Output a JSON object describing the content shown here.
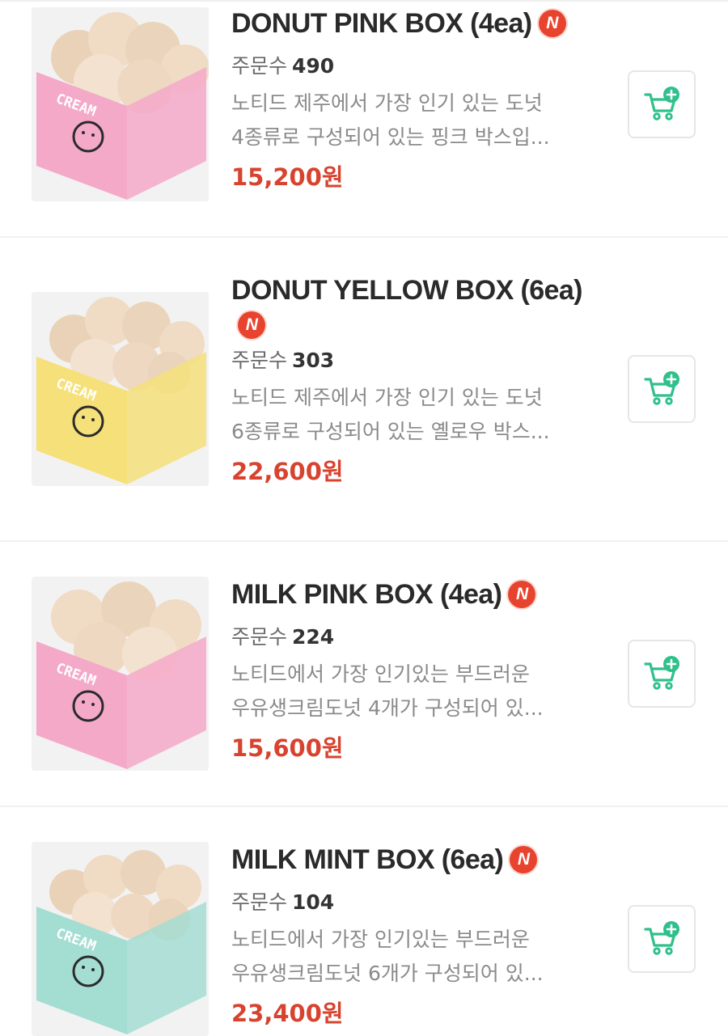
{
  "labels": {
    "orders_prefix": "주문수"
  },
  "badge_text": "N",
  "icons": {
    "badge": "new-badge-icon",
    "cart": "cart-add-icon"
  },
  "colors": {
    "price": "#d8432f",
    "badge": "#e8432e",
    "cart": "#2fc08b"
  },
  "products": [
    {
      "title": "DONUT PINK BOX (4ea)",
      "orders": "490",
      "desc_line1": "노티드 제주에서 가장 인기 있는 도넛",
      "desc_line2": "4종류로 구성되어 있는 핑크 박스입...",
      "price": "15,200원",
      "box_color": "#f4a9c9",
      "box_text": "CREAM"
    },
    {
      "title": "DONUT YELLOW BOX (6ea)",
      "orders": "303",
      "desc_line1": "노티드 제주에서 가장 인기 있는 도넛",
      "desc_line2": "6종류로 구성되어 있는 옐로우 박스...",
      "price": "22,600원",
      "box_color": "#f5e07a",
      "box_text": "CREAM"
    },
    {
      "title": "MILK PINK BOX (4ea)",
      "orders": "224",
      "desc_line1": "노티드에서 가장 인기있는 부드러운",
      "desc_line2": "우유생크림도넛 4개가 구성되어 있...",
      "price": "15,600원",
      "box_color": "#f4a9c9",
      "box_text": "CREAM"
    },
    {
      "title": "MILK MINT BOX (6ea)",
      "orders": "104",
      "desc_line1": "노티드에서 가장 인기있는 부드러운",
      "desc_line2": "우유생크림도넛 6개가 구성되어 있...",
      "price": "23,400원",
      "box_color": "#a4ddd2",
      "box_text": "CREAM"
    }
  ]
}
